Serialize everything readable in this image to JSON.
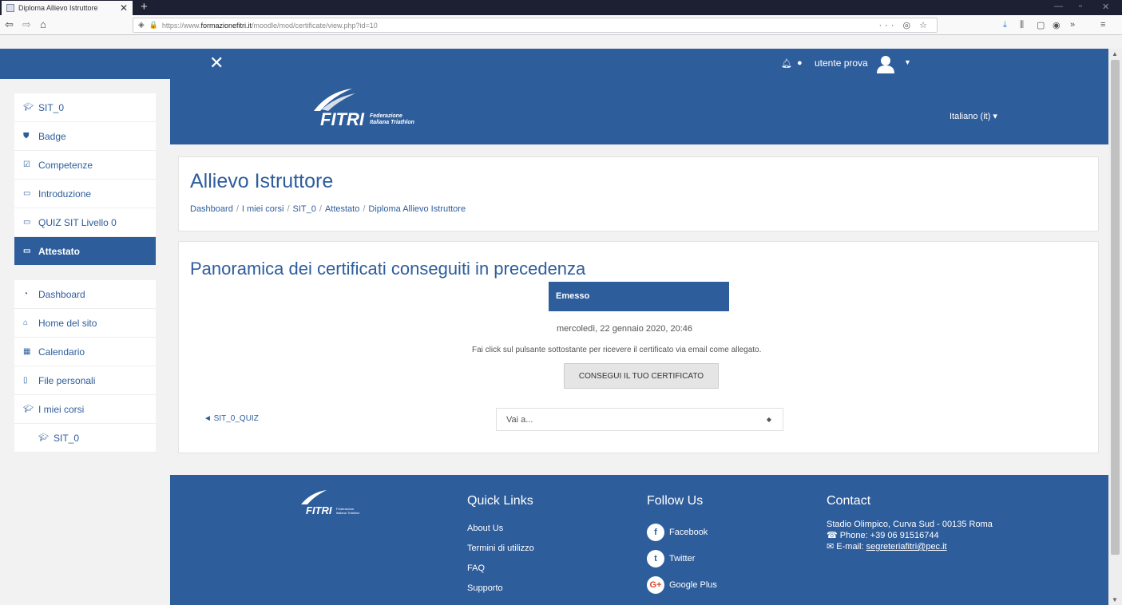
{
  "browser": {
    "tab_title": "Diploma Allievo Istruttore",
    "tab_close": "✕",
    "new_tab": "+",
    "url_prefix": "https://www.",
    "url_domain": "formazionefitri.it",
    "url_path": "/moodle/mod/certificate/view.php?id=10"
  },
  "topnav": {
    "close_glyph": "✕",
    "user_name": "utente prova"
  },
  "banner": {
    "logo_text": "FITRI",
    "logo_sub1": "Federazione",
    "logo_sub2": "Italiana Triathlon",
    "language": "Italiano (it) ▾"
  },
  "sidebar": {
    "course_items": [
      {
        "label": "SIT_0",
        "icon": "graduation-cap-icon"
      },
      {
        "label": "Badge",
        "icon": "shield-icon"
      },
      {
        "label": "Competenze",
        "icon": "checkbox-icon"
      },
      {
        "label": "Introduzione",
        "icon": "folder-icon"
      },
      {
        "label": "QUIZ SIT Livello 0",
        "icon": "folder-icon"
      },
      {
        "label": "Attestato",
        "icon": "folder-icon",
        "active": true
      }
    ],
    "site_items": [
      {
        "label": "Dashboard",
        "icon": "dashboard-icon"
      },
      {
        "label": "Home del sito",
        "icon": "home-icon"
      },
      {
        "label": "Calendario",
        "icon": "calendar-icon"
      },
      {
        "label": "File personali",
        "icon": "file-icon"
      },
      {
        "label": "I miei corsi",
        "icon": "graduation-cap-icon"
      },
      {
        "label": "SIT_0",
        "icon": "graduation-cap-icon"
      }
    ]
  },
  "page": {
    "title": "Allievo Istruttore",
    "breadcrumb": [
      "Dashboard",
      "I miei corsi",
      "SIT_0",
      "Attestato",
      "Diploma Allievo Istruttore"
    ]
  },
  "certificates": {
    "heading": "Panoramica dei certificati conseguiti in precedenza",
    "column_header": "Emesso",
    "issued_date": "mercoledì, 22 gennaio 2020, 20:46",
    "instructions": "Fai click sul pulsante sottostante per ricevere il certificato via email come allegato.",
    "button_label": "CONSEGUI IL TUO CERTIFICATO",
    "prev_link": "◄ SIT_0_QUIZ",
    "jump_placeholder": "Vai a..."
  },
  "footer": {
    "quick_links_title": "Quick Links",
    "quick_links": [
      "About Us",
      "Termini di utilizzo",
      "FAQ",
      "Supporto"
    ],
    "follow_title": "Follow Us",
    "social": [
      {
        "label": "Facebook",
        "glyph": "f"
      },
      {
        "label": "Twitter",
        "glyph": "t"
      },
      {
        "label": "Google Plus",
        "glyph": "G+"
      }
    ],
    "contact_title": "Contact",
    "address": "Stadio Olimpico, Curva Sud - 00135 Roma",
    "phone": "Phone: +39 06 91516744",
    "email_label": "E-mail:",
    "email": "segreteriafitri@pec.it"
  },
  "colors": {
    "brand_blue": "#2e5d9c",
    "page_bg": "#f2f2f2"
  }
}
